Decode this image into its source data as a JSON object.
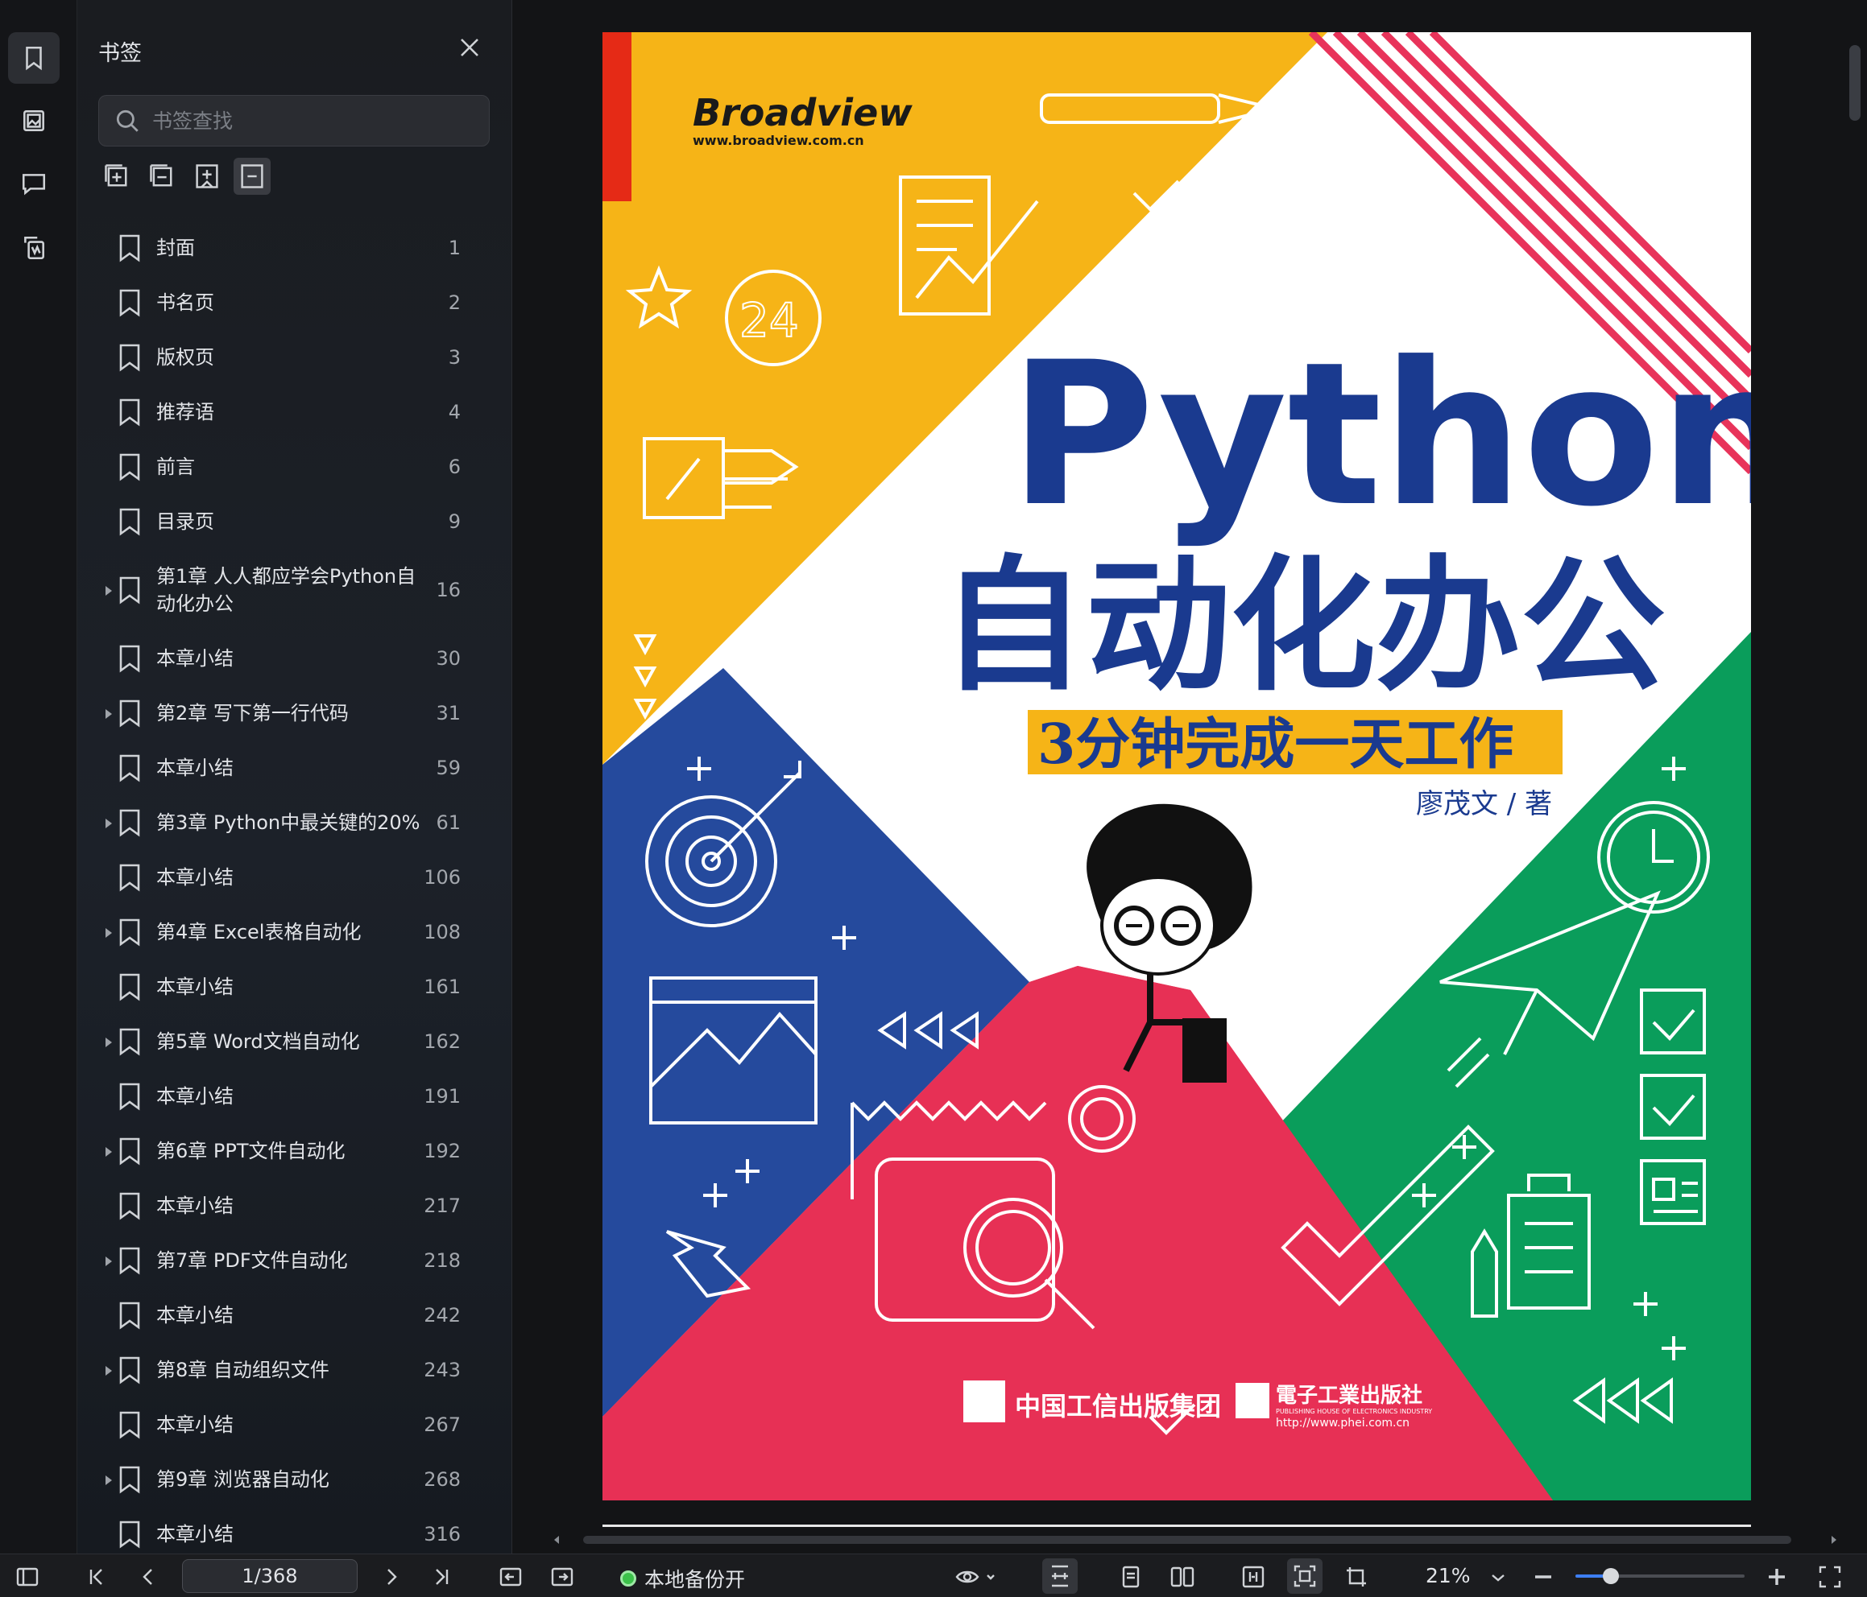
{
  "panel": {
    "title": "书签",
    "search_placeholder": "书签查找"
  },
  "bookmarks": [
    {
      "label": "封面",
      "page": "1",
      "expandable": false
    },
    {
      "label": "书名页",
      "page": "2",
      "expandable": false
    },
    {
      "label": "版权页",
      "page": "3",
      "expandable": false
    },
    {
      "label": "推荐语",
      "page": "4",
      "expandable": false
    },
    {
      "label": "前言",
      "page": "6",
      "expandable": false
    },
    {
      "label": "目录页",
      "page": "9",
      "expandable": false
    },
    {
      "label": "第1章 人人都应学会Python自动化办公",
      "page": "16",
      "expandable": true,
      "tall": true
    },
    {
      "label": "本章小结",
      "page": "30",
      "expandable": false
    },
    {
      "label": "第2章 写下第一行代码",
      "page": "31",
      "expandable": true
    },
    {
      "label": "本章小结",
      "page": "59",
      "expandable": false
    },
    {
      "label": "第3章 Python中最关键的20%",
      "page": "61",
      "expandable": true
    },
    {
      "label": "本章小结",
      "page": "106",
      "expandable": false
    },
    {
      "label": "第4章 Excel表格自动化",
      "page": "108",
      "expandable": true
    },
    {
      "label": "本章小结",
      "page": "161",
      "expandable": false
    },
    {
      "label": "第5章 Word文档自动化",
      "page": "162",
      "expandable": true
    },
    {
      "label": "本章小结",
      "page": "191",
      "expandable": false
    },
    {
      "label": "第6章 PPT文件自动化",
      "page": "192",
      "expandable": true
    },
    {
      "label": "本章小结",
      "page": "217",
      "expandable": false
    },
    {
      "label": "第7章 PDF文件自动化",
      "page": "218",
      "expandable": true
    },
    {
      "label": "本章小结",
      "page": "242",
      "expandable": false
    },
    {
      "label": "第8章 自动组织文件",
      "page": "243",
      "expandable": true
    },
    {
      "label": "本章小结",
      "page": "267",
      "expandable": false
    },
    {
      "label": "第9章 浏览器自动化",
      "page": "268",
      "expandable": true
    },
    {
      "label": "本章小结",
      "page": "316",
      "expandable": false
    }
  ],
  "cover": {
    "publisher_logo": "Broadview",
    "publisher_url": "www.broadview.com.cn",
    "title_en": "Python",
    "title_cn": "自动化办公",
    "subtitle": "3分钟完成一天工作",
    "author": "廖茂文 / 著",
    "group": "中国工信出版集团",
    "press": "電子工業出版社",
    "press_en": "PUBLISHING HOUSE OF ELECTRONICS INDUSTRY",
    "press_url": "http://www.phei.com.cn",
    "timer_number": "24",
    "colors": {
      "yellow": "#f6b417",
      "blue": "#254a9d",
      "red": "#e73055",
      "green": "#0a9d5b",
      "navy": "#1a3a8f",
      "stripe": "#e8335a"
    }
  },
  "status": {
    "page_indicator": "1/368",
    "backup_label": "本地备份开",
    "zoom_level": "21%",
    "zoom_fraction": 0.21
  }
}
